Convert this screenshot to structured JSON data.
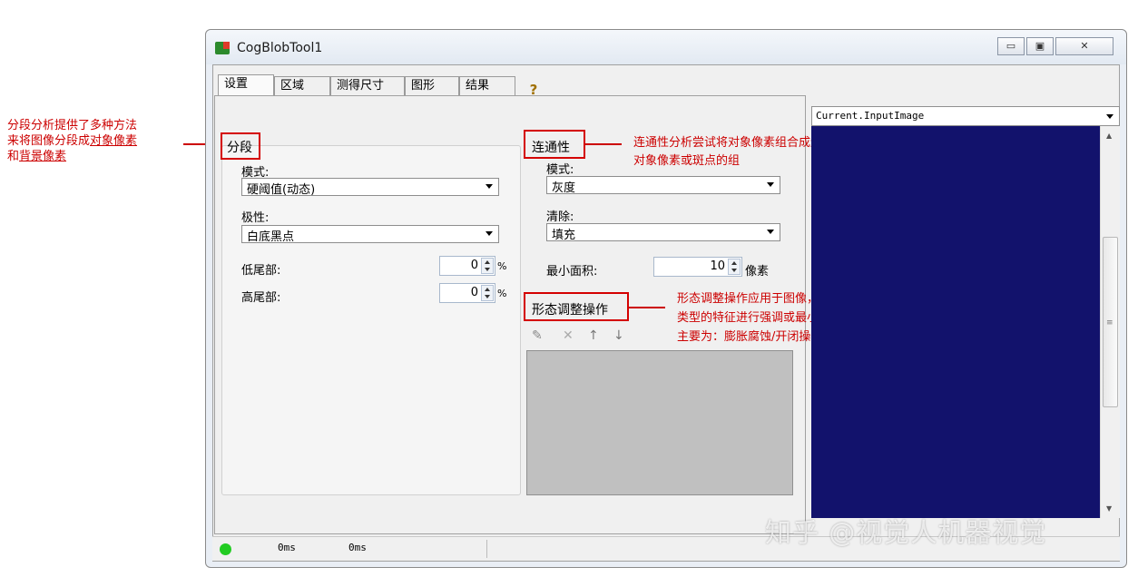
{
  "annotations": {
    "segment_line1": "分段分析提供了多种方法",
    "segment_line2_prefix": "来将图像分段成",
    "segment_line2_link": "对象像素",
    "segment_line3_prefix": "和",
    "segment_line3_link": "背景像素",
    "connectivity_line1": "连通性分析尝试将对象像素组合成连接在一起的",
    "connectivity_line2": "对象像素或斑点的组",
    "morph_line1": "形态调整操作应用于图像，从而对图像中具体",
    "morph_line2": "类型的特征进行强调或最小化处理",
    "morph_line3": "主要为：膨胀腐蚀/开闭操作"
  },
  "window": {
    "title": "CogBlobTool1",
    "minimize_icon": "minimize-icon",
    "maximize_icon": "maximize-icon",
    "close_icon": "close-icon"
  },
  "toolbar": {
    "icons": [
      "run-icon",
      "electric-icon",
      "display-icon",
      "copy-icon",
      "open-folder-icon",
      "save-icon",
      "layout-icon",
      "reset-icon",
      "number-icon",
      "measure-icon",
      "help-icon"
    ]
  },
  "tabs": [
    {
      "label": "设置"
    },
    {
      "label": "区域"
    },
    {
      "label": "测得尺寸"
    },
    {
      "label": "图形"
    },
    {
      "label": "结果"
    }
  ],
  "segmentation": {
    "title": "分段",
    "mode_label": "模式:",
    "mode_value": "硬阈值(动态)",
    "polarity_label": "极性:",
    "polarity_value": "白底黑点",
    "low_tail_label": "低尾部:",
    "low_tail_value": "0",
    "high_tail_label": "高尾部:",
    "high_tail_value": "0",
    "percent_unit": "%"
  },
  "connectivity": {
    "title": "连通性",
    "mode_label": "模式:",
    "mode_value": "灰度",
    "cleanup_label": "清除:",
    "cleanup_value": "填充",
    "min_area_label": "最小面积:",
    "min_area_value": "10",
    "min_area_unit": "像素"
  },
  "morphology": {
    "title": "形态调整操作",
    "new_icon": "new-op-icon",
    "delete_icon": "delete-icon",
    "up_icon": "arrow-up-icon",
    "down_icon": "arrow-down-icon"
  },
  "image_display": {
    "selected": "Current.InputImage"
  },
  "status": {
    "indicator_color": "#22cc22",
    "time1": "0ms",
    "time2": "0ms"
  },
  "watermark": "知乎 @视觉人机器视觉",
  "colors": {
    "annotation": "#cc0000",
    "image_background": "#12126c"
  }
}
